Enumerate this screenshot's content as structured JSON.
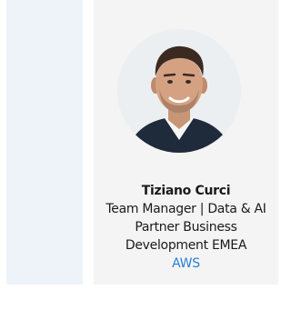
{
  "speaker": {
    "name": "Tiziano Curci",
    "role": "Team Manager | Data & AI Partner Business Development EMEA",
    "company": "AWS"
  },
  "colors": {
    "left_panel": "#eef3f9",
    "card_background": "#f4f4f4",
    "link": "#2b7fd6"
  }
}
